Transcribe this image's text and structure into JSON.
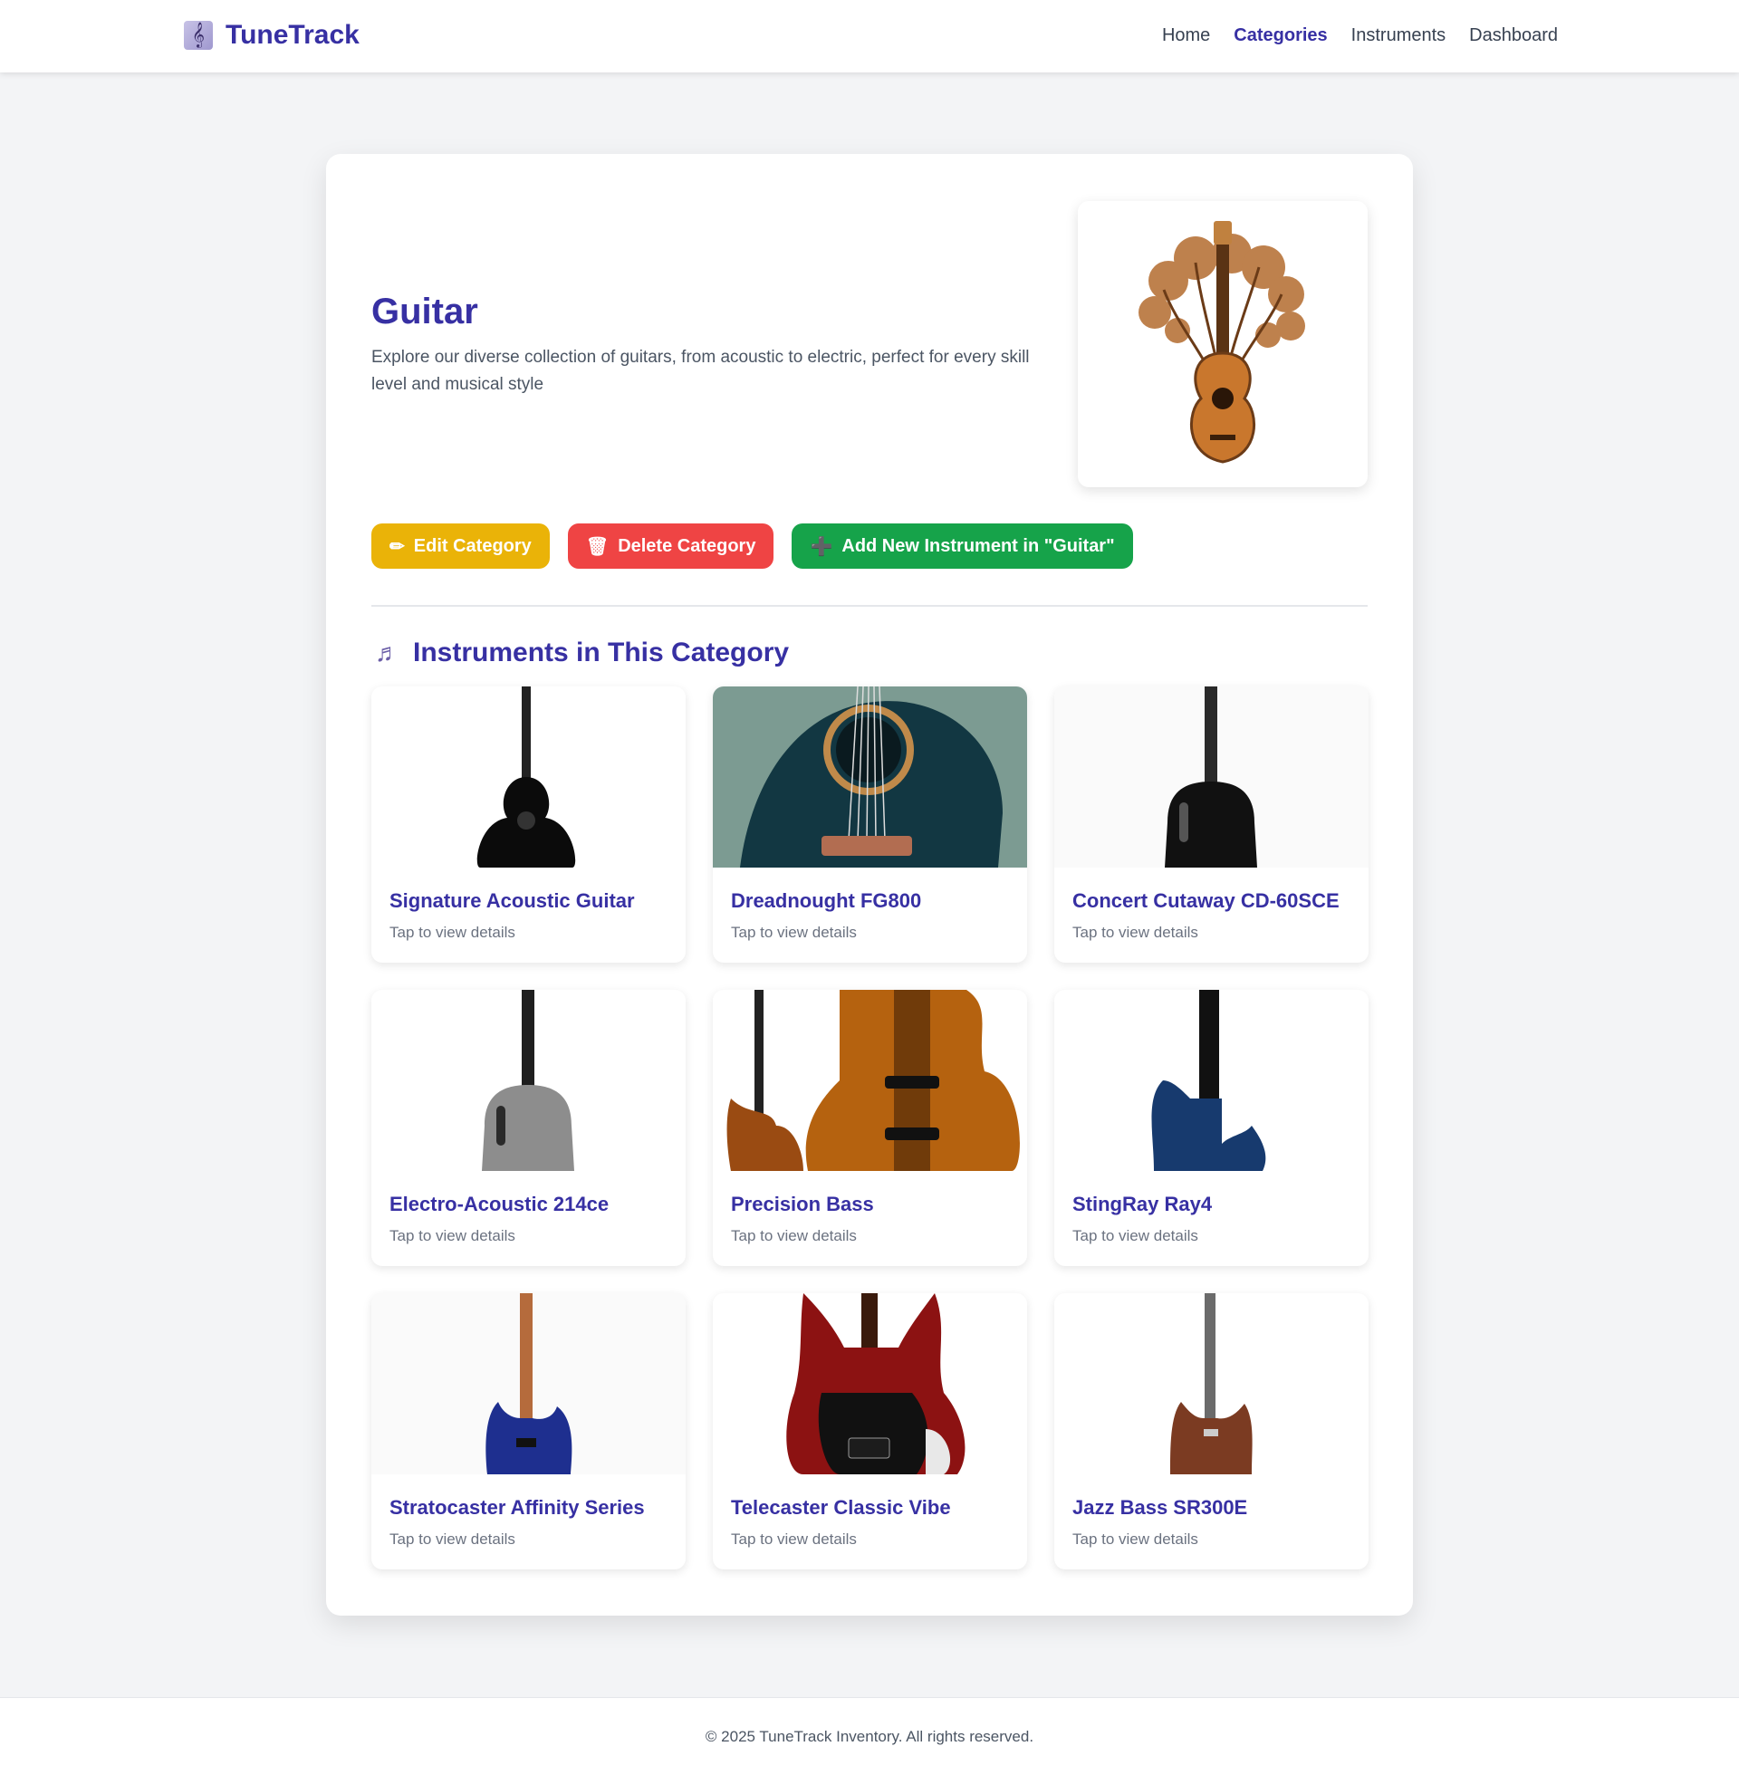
{
  "brand": {
    "name": "TuneTrack",
    "icon": "treble-clef-icon"
  },
  "nav": {
    "links": [
      {
        "label": "Home",
        "active": false
      },
      {
        "label": "Categories",
        "active": true
      },
      {
        "label": "Instruments",
        "active": false
      },
      {
        "label": "Dashboard",
        "active": false
      }
    ]
  },
  "category": {
    "title": "Guitar",
    "description": "Explore our diverse collection of guitars, from acoustic to electric, perfect for every skill level and musical style"
  },
  "actions": {
    "edit_label": "Edit Category",
    "delete_label": "Delete Category",
    "add_label": "Add New Instrument in \"Guitar\""
  },
  "section": {
    "title": "Instruments in This Category"
  },
  "instruments": [
    {
      "name": "Signature Acoustic Guitar",
      "subtitle": "Tap to view details"
    },
    {
      "name": "Dreadnought FG800",
      "subtitle": "Tap to view details"
    },
    {
      "name": "Concert Cutaway CD-60SCE",
      "subtitle": "Tap to view details"
    },
    {
      "name": "Electro-Acoustic 214ce",
      "subtitle": "Tap to view details"
    },
    {
      "name": "Precision Bass",
      "subtitle": "Tap to view details"
    },
    {
      "name": "StingRay Ray4",
      "subtitle": "Tap to view details"
    },
    {
      "name": "Stratocaster Affinity Series",
      "subtitle": "Tap to view details"
    },
    {
      "name": "Telecaster Classic Vibe",
      "subtitle": "Tap to view details"
    },
    {
      "name": "Jazz Bass SR300E",
      "subtitle": "Tap to view details"
    }
  ],
  "footer": {
    "text": "© 2025 TuneTrack Inventory. All rights reserved."
  },
  "colors": {
    "primary": "#3730a3",
    "edit": "#eab308",
    "delete": "#ef4444",
    "add": "#16a34a",
    "background": "#f3f4f6"
  }
}
